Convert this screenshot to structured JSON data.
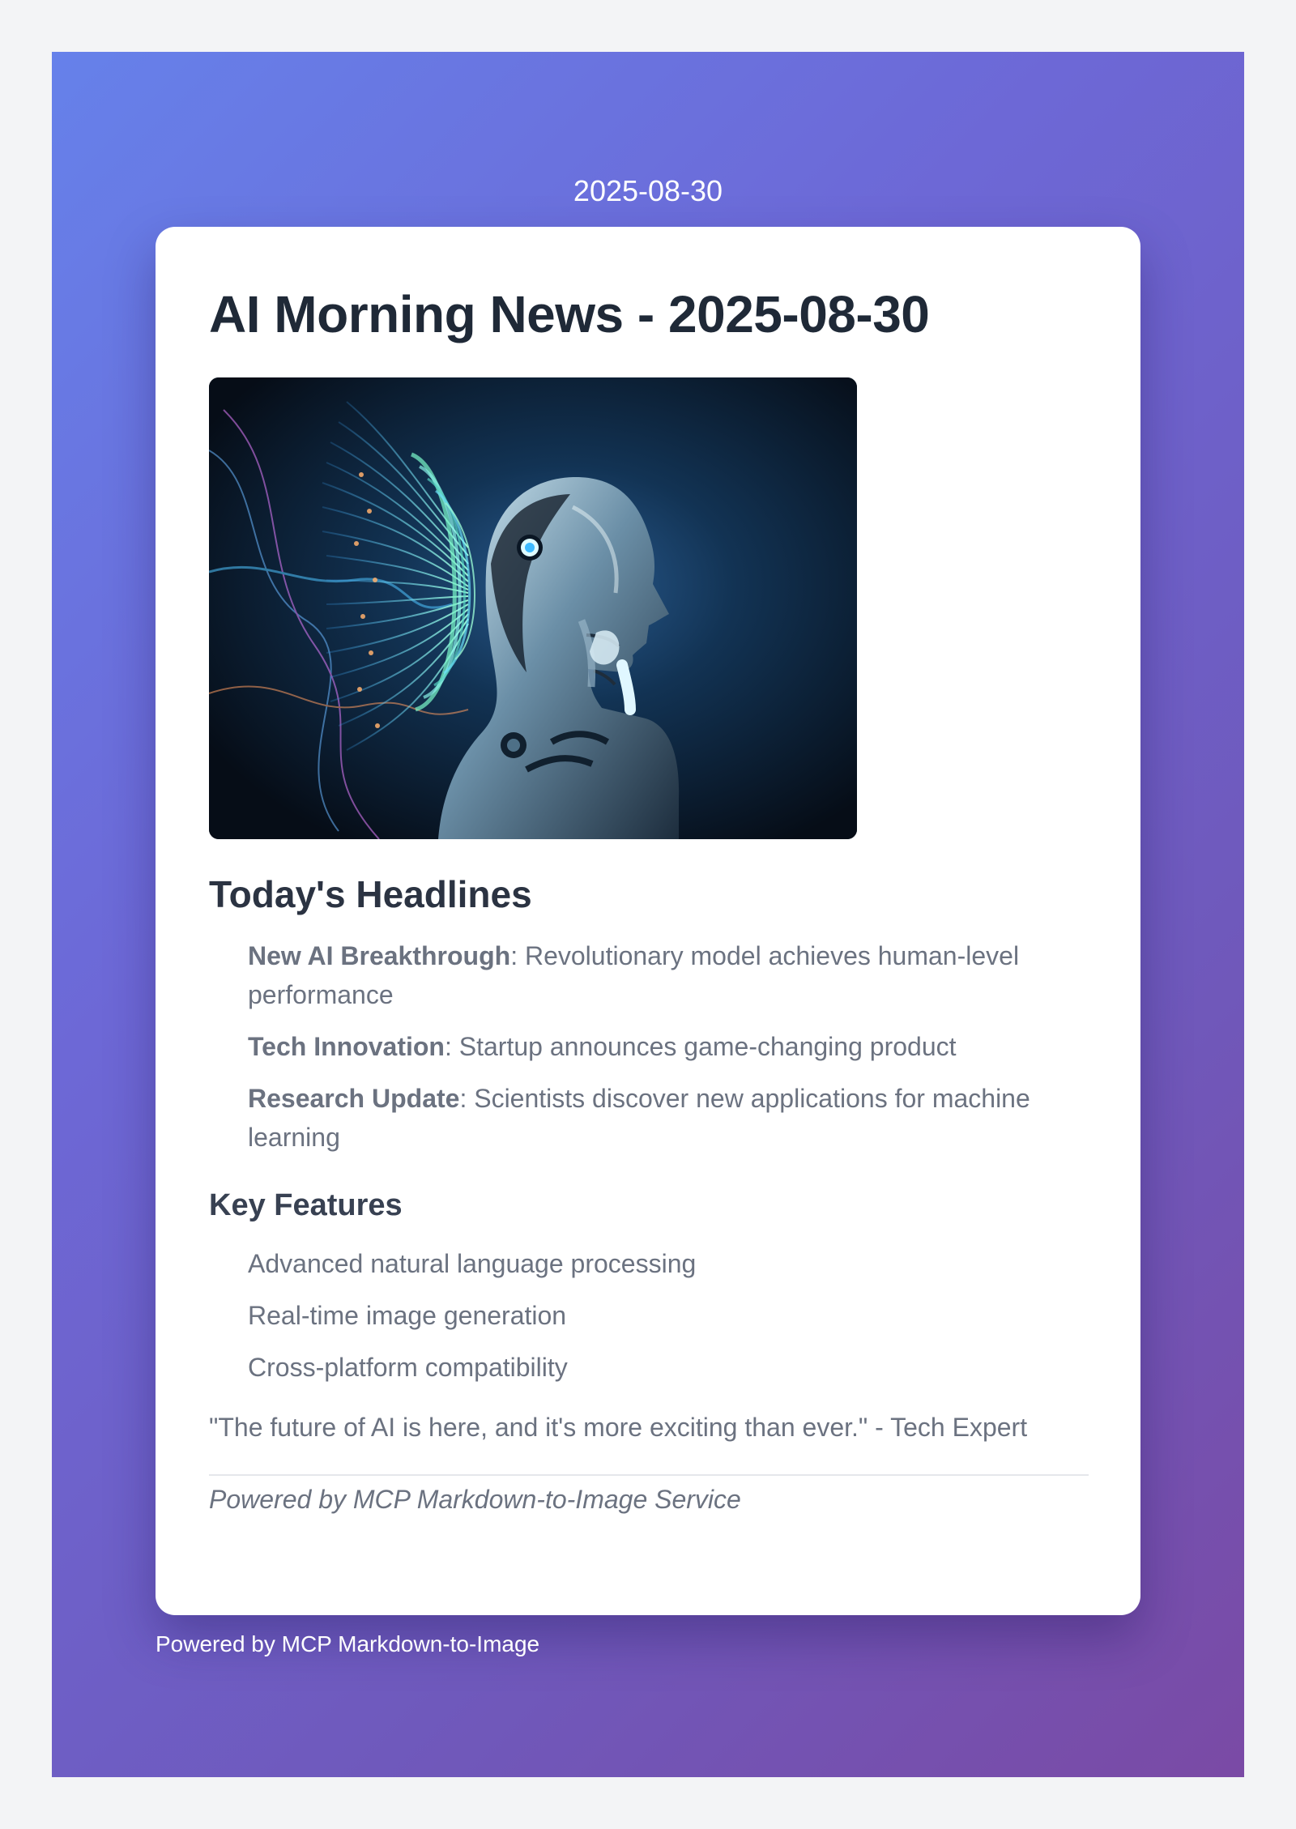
{
  "top_date": "2025-08-30",
  "article": {
    "title": "AI Morning News - 2025-08-30",
    "hero_image": "ai-robot-thinking-image",
    "headlines_heading": "Today's Headlines",
    "headlines": [
      {
        "label": "New AI Breakthrough",
        "text": ": Revolutionary model achieves human-level performance"
      },
      {
        "label": "Tech Innovation",
        "text": ": Startup announces game-changing product"
      },
      {
        "label": "Research Update",
        "text": ": Scientists discover new applications for machine learning"
      }
    ],
    "features_heading": "Key Features",
    "features": [
      "Advanced natural language processing",
      "Real-time image generation",
      "Cross-platform compatibility"
    ],
    "quote": "\"The future of AI is here, and it's more exciting than ever.\" - Tech Expert",
    "powered_note": "Powered by MCP Markdown-to-Image Service"
  },
  "footer": "Powered by MCP Markdown-to-Image",
  "colors": {
    "gradient_start": "#6681ea",
    "gradient_end": "#7a4aa5",
    "card_background": "#ffffff",
    "title_text": "#1f2937",
    "body_text": "#6b7280"
  }
}
